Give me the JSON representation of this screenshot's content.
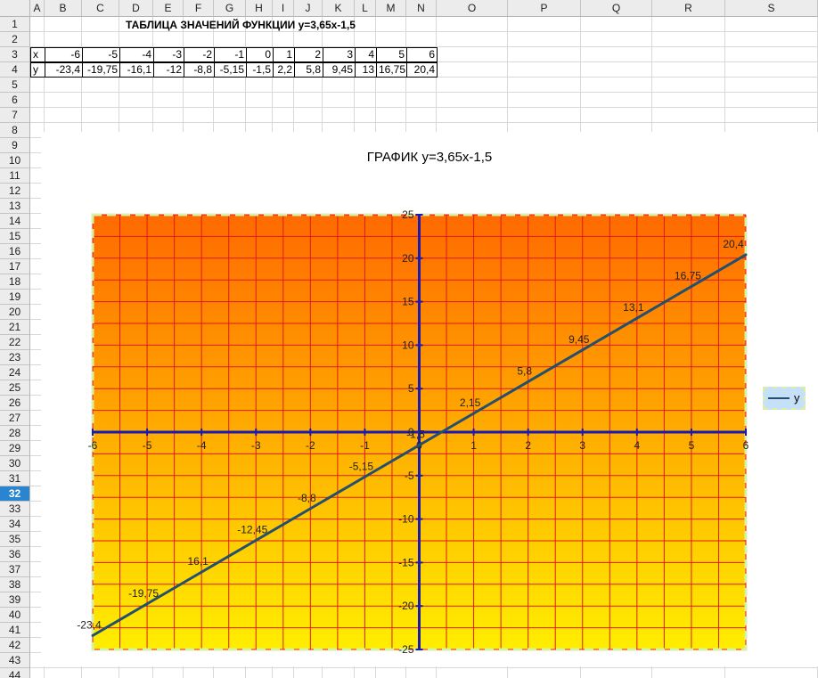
{
  "spreadsheet": {
    "columns": [
      "A",
      "B",
      "C",
      "D",
      "E",
      "F",
      "G",
      "H",
      "I",
      "J",
      "K",
      "L",
      "M",
      "N",
      "O",
      "P",
      "Q",
      "R",
      "S"
    ],
    "rows": [
      "1",
      "2",
      "3",
      "4",
      "5",
      "6",
      "7",
      "8",
      "9",
      "10",
      "11",
      "12",
      "13",
      "14",
      "15",
      "16",
      "17",
      "18",
      "19",
      "20",
      "21",
      "22",
      "23",
      "24",
      "25",
      "26",
      "27",
      "28",
      "29",
      "30",
      "31",
      "32",
      "33",
      "34",
      "35",
      "36",
      "37",
      "38",
      "39",
      "40",
      "41",
      "42",
      "43",
      "44"
    ],
    "active_row": "32",
    "title": "ТАБЛИЦА ЗНАЧЕНИЙ ФУНКЦИИ y=3,65x-1,5",
    "table": {
      "x_label": "x",
      "y_label": "y",
      "x_values": [
        "-6",
        "-5",
        "-4",
        "-3",
        "-2",
        "-1",
        "0",
        "1",
        "2",
        "3",
        "4",
        "5",
        "6"
      ],
      "y_values": [
        "-23,4",
        "-19,75",
        "-16,1",
        "-12",
        "-8,8",
        "-5,15",
        "-1,5",
        "2,2",
        "5,8",
        "9,45",
        "13",
        "16,75",
        "20,4"
      ]
    }
  },
  "chart_data": {
    "type": "line",
    "title": "ГРАФИК y=3,65x-1,5",
    "x": [
      -6,
      -5,
      -4,
      -3,
      -2,
      -1,
      0,
      1,
      2,
      3,
      4,
      5,
      6
    ],
    "series": [
      {
        "name": "y",
        "values": [
          -23.4,
          -19.75,
          -16.1,
          -12.45,
          -8.8,
          -5.15,
          -1.5,
          2.15,
          5.8,
          9.45,
          13.1,
          16.75,
          20.4
        ],
        "labels": [
          "-23,4",
          "-19,75",
          "16,1",
          "-12,45",
          "-8,8",
          "-5,15",
          "-1,5",
          "2,15",
          "5,8",
          "9,45",
          "13,1",
          "16,75",
          "20,4"
        ]
      }
    ],
    "xlim": [
      -6,
      6
    ],
    "ylim": [
      -25,
      25
    ],
    "x_ticks": [
      "-6",
      "-5",
      "-4",
      "-3",
      "-2",
      "-1",
      "0",
      "1",
      "2",
      "3",
      "4",
      "5",
      "6"
    ],
    "y_ticks": [
      "25",
      "20",
      "15",
      "10",
      "5",
      "0",
      "-5",
      "-10",
      "-15",
      "-20",
      "-25"
    ],
    "grid": true,
    "legend_position": "right",
    "colors": {
      "background_top": "#ff6a00",
      "background_bottom": "#ffee00",
      "grid": "#e01a1a",
      "axes": "#1a1ab0",
      "line": "#24506e",
      "plot_border": "#d8f0a8",
      "legend_bg": "#c6e0f7"
    }
  }
}
